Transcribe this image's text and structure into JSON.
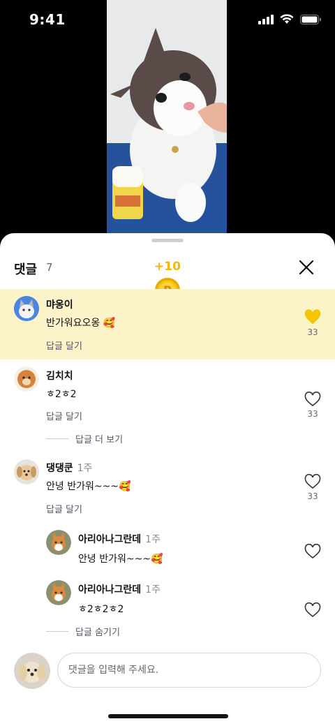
{
  "status_bar": {
    "time": "9:41"
  },
  "sheet": {
    "title": "댓글",
    "count": "7",
    "reward": "+10",
    "coin_symbol": "P"
  },
  "comments": [
    {
      "name": "먀옹이",
      "time": "",
      "text": "반가워요오옹 🥰",
      "reply": "답글 달기",
      "likes": "33",
      "liked": true
    },
    {
      "name": "김치치",
      "time": "",
      "text": "ㅎ2ㅎ2",
      "reply": "답글 달기",
      "likes": "33",
      "liked": false,
      "more": "답글 더 보기"
    },
    {
      "name": "댕댕쿤",
      "time": "1주",
      "text": "안녕 반가워~~~🥰",
      "reply": "답글 달기",
      "likes": "33",
      "liked": false,
      "replies": [
        {
          "name": "아리아나그란데",
          "time": "1주",
          "text": "안녕 반가워~~~🥰"
        },
        {
          "name": "아리아나그란데",
          "time": "1주",
          "text": "ㅎ2ㅎ2ㅎ2"
        }
      ],
      "hide": "답글 숨기기"
    }
  ],
  "input": {
    "placeholder": "댓글을 입력해 주세요."
  },
  "colors": {
    "accent": "#f7c400",
    "highlight": "#fdf3c8"
  }
}
